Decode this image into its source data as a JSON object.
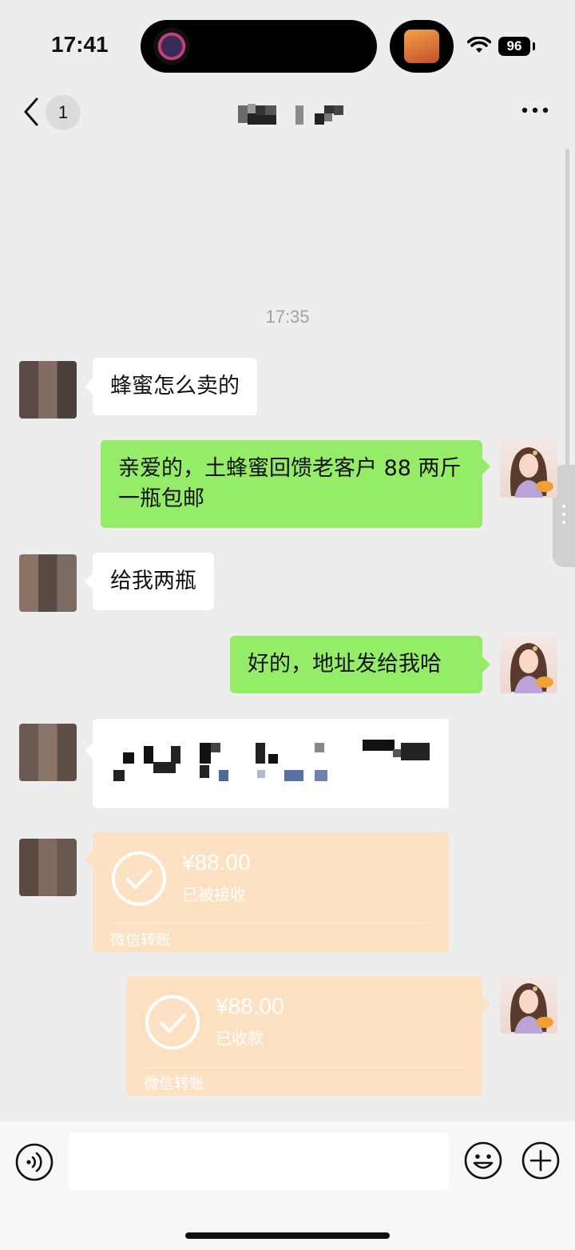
{
  "status_bar": {
    "time": "17:41",
    "battery": "96"
  },
  "nav": {
    "unread_count": "1"
  },
  "timestamp": "17:35",
  "messages": [
    {
      "side": "left",
      "text": "蜂蜜怎么卖的"
    },
    {
      "side": "right",
      "text": "亲爱的，土蜂蜜回馈老客户 88 两斤一瓶包邮"
    },
    {
      "side": "left",
      "text": "给我两瓶"
    },
    {
      "side": "right",
      "text": "好的，地址发给我哈"
    }
  ],
  "transfers": [
    {
      "side": "left",
      "amount": "¥88.00",
      "status": "已被接收",
      "footer": "微信转账"
    },
    {
      "side": "right",
      "amount": "¥88.00",
      "status": "已收款",
      "footer": "微信转账"
    }
  ],
  "colors": {
    "bg": "#ededed",
    "bubble_self": "#95ec69",
    "bubble_other": "#ffffff",
    "transfer": "#fde1c3"
  },
  "icons": [
    "back-icon",
    "more-icon",
    "voice-icon",
    "emoji-icon",
    "plus-icon",
    "wifi-icon",
    "battery-icon"
  ]
}
